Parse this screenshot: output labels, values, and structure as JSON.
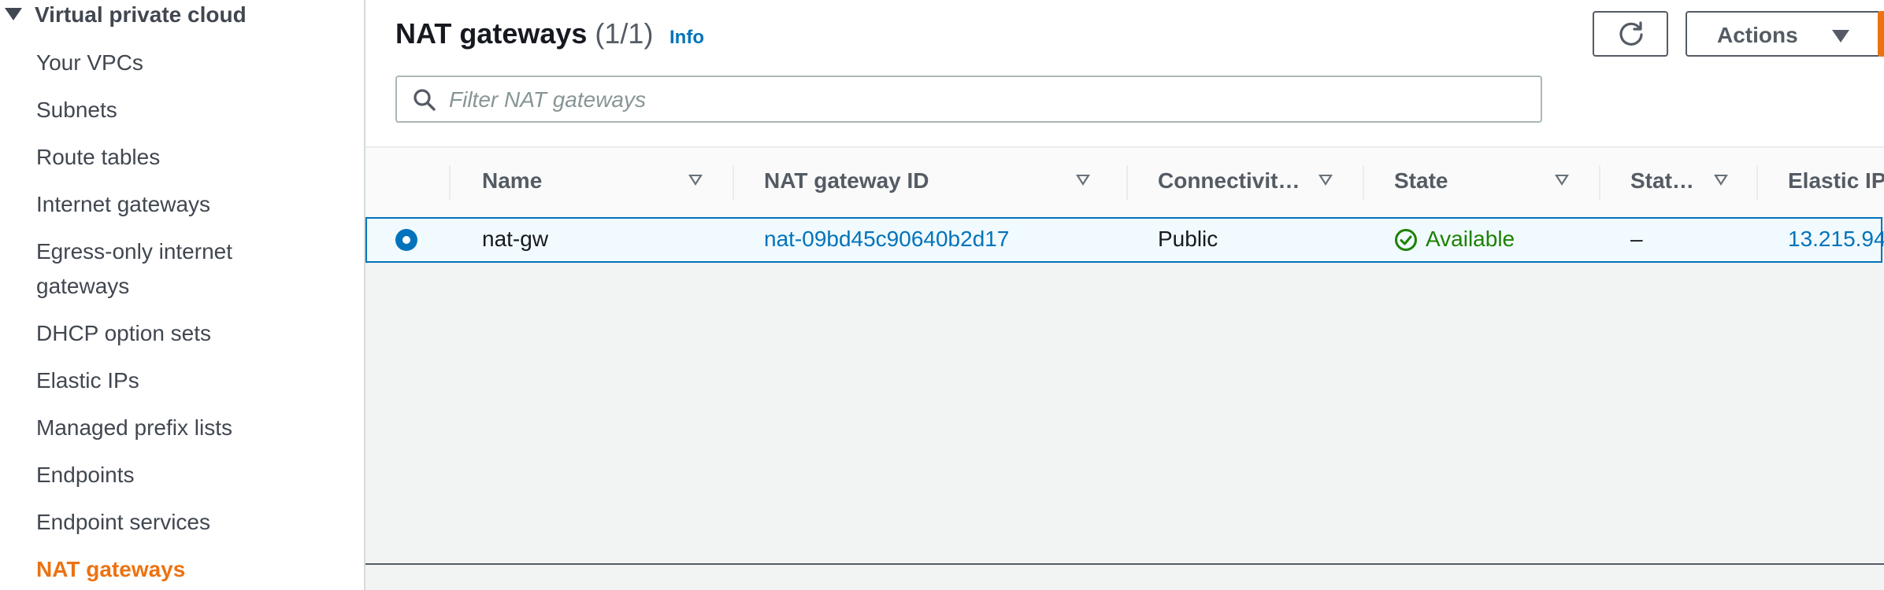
{
  "sidebar": {
    "section_label": "Virtual private cloud",
    "items": [
      {
        "label": "Your VPCs"
      },
      {
        "label": "Subnets"
      },
      {
        "label": "Route tables"
      },
      {
        "label": "Internet gateways"
      },
      {
        "label": "Egress-only internet"
      },
      {
        "label": "gateways"
      },
      {
        "label": "DHCP option sets"
      },
      {
        "label": "Elastic IPs"
      },
      {
        "label": "Managed prefix lists"
      },
      {
        "label": "Endpoints"
      },
      {
        "label": "Endpoint services"
      },
      {
        "label": "NAT gateways"
      }
    ]
  },
  "header": {
    "title": "NAT gateways",
    "count": "(1/1)",
    "info_label": "Info",
    "actions_label": "Actions",
    "search_placeholder": "Filter NAT gateways"
  },
  "table": {
    "columns": [
      "Name",
      "NAT gateway ID",
      "Connectivit…",
      "State",
      "Stat…",
      "Elastic IP"
    ],
    "rows": [
      {
        "name": "nat-gw",
        "nat_gateway_id": "nat-09bd45c90640b2d17",
        "connectivity": "Public",
        "state": "Available",
        "state_message": "–",
        "elastic_ip": "13.215.94"
      }
    ]
  },
  "colors": {
    "accent": "#ec7211",
    "link": "#0073bb",
    "success": "#1d8102"
  }
}
